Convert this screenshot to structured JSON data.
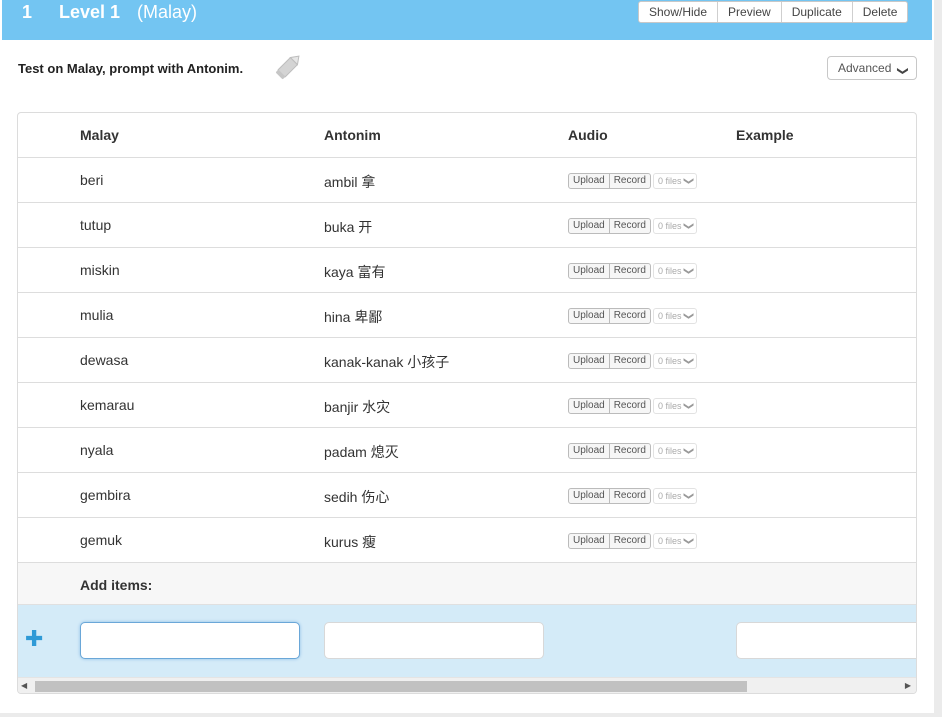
{
  "level": {
    "number": "1",
    "title": "Level 1",
    "language": "(Malay)"
  },
  "header_buttons": {
    "show_hide": "Show/Hide",
    "preview": "Preview",
    "duplicate": "Duplicate",
    "delete": "Delete"
  },
  "test_description": "Test on Malay, prompt with Antonim.",
  "advanced_label": "Advanced",
  "columns": {
    "malay": "Malay",
    "antonim": "Antonim",
    "audio": "Audio",
    "example": "Example"
  },
  "audio_controls": {
    "upload": "Upload",
    "record": "Record",
    "files": "0 files"
  },
  "rows": [
    {
      "malay": "beri",
      "antonim": "ambil 拿"
    },
    {
      "malay": "tutup",
      "antonim": "buka 开"
    },
    {
      "malay": "miskin",
      "antonim": "kaya 富有"
    },
    {
      "malay": "mulia",
      "antonim": "hina 卑鄙"
    },
    {
      "malay": "dewasa",
      "antonim": "kanak-kanak 小孩子"
    },
    {
      "malay": "kemarau",
      "antonim": "banjir 水灾"
    },
    {
      "malay": "nyala",
      "antonim": "padam 熄灭"
    },
    {
      "malay": "gembira",
      "antonim": "sedih 伤心"
    },
    {
      "malay": "gemuk",
      "antonim": "kurus 瘦"
    }
  ],
  "add_items_label": "Add items:",
  "colors": {
    "header_bg": "#73c5f2",
    "add_row_bg": "#d4ebf8",
    "plus": "#2f9ad6"
  },
  "icons": {
    "edit": "pencil-icon",
    "advanced": "chevron-down-icon",
    "add": "plus-icon",
    "files_dropdown": "chevron-down-icon"
  }
}
